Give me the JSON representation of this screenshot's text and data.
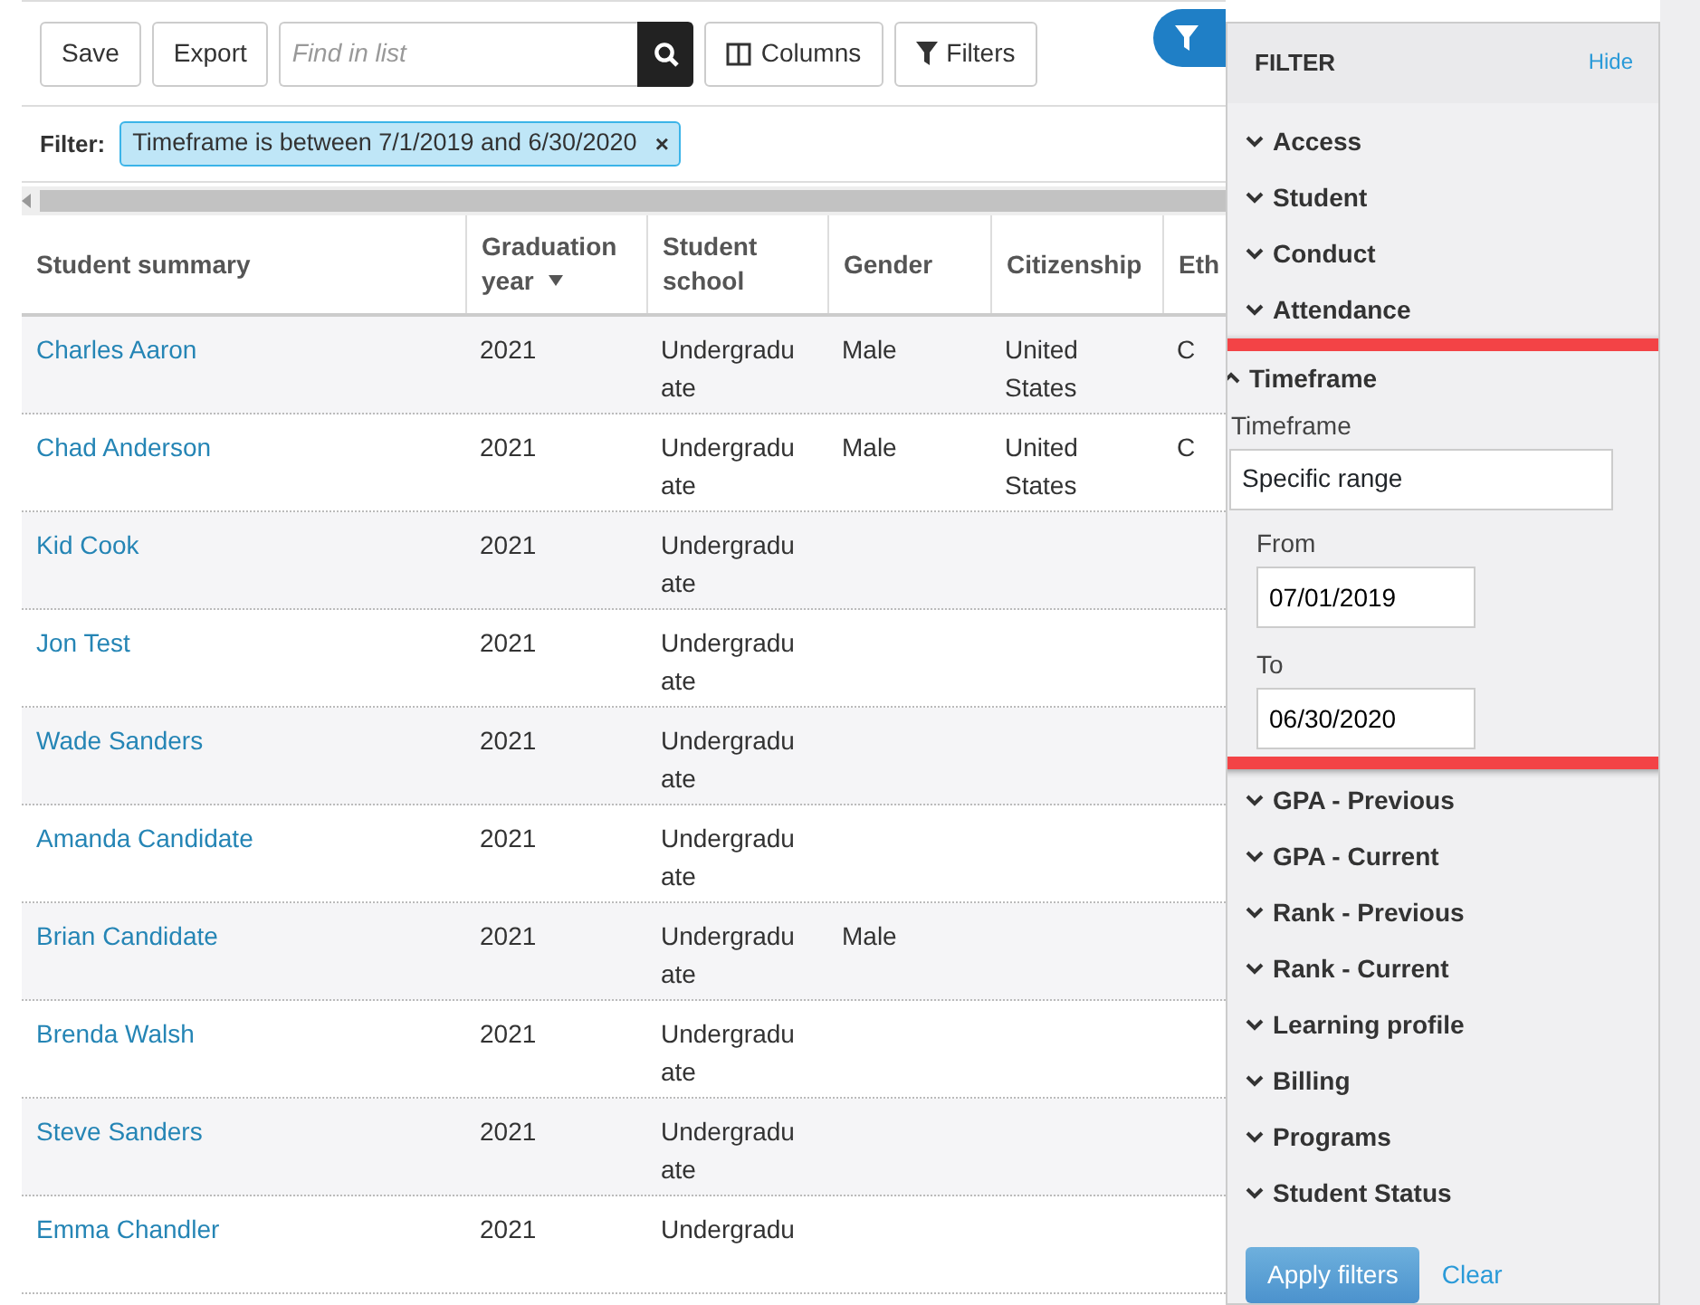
{
  "toolbar": {
    "buttons": [
      {
        "label": "Save",
        "kind": "plain"
      },
      {
        "label": "Export",
        "kind": "plain"
      },
      {
        "label": "Columns",
        "kind": "columns"
      },
      {
        "label": "Filters",
        "kind": "filter"
      }
    ],
    "search": {
      "placeholder": "Find in list"
    }
  },
  "filter_bar": {
    "label": "Filter:",
    "chips": [
      {
        "text": "Timeframe is between 7/1/2019 and 6/30/2020",
        "remove": "×"
      }
    ]
  },
  "table": {
    "columns": [
      {
        "label": "Student summary",
        "sorted": false
      },
      {
        "label": "Graduation year",
        "sorted": true
      },
      {
        "label": "Student school",
        "sorted": false
      },
      {
        "label": "Gender",
        "sorted": false
      },
      {
        "label": "Citizenship",
        "sorted": false
      },
      {
        "label": "Eth",
        "sorted": false
      }
    ],
    "rows": [
      [
        "Charles Aaron",
        "2021",
        "Undergradu ate",
        "Male",
        "United States",
        "C"
      ],
      [
        "Chad Anderson",
        "2021",
        "Undergradu ate",
        "Male",
        "United States",
        "C"
      ],
      [
        "Kid Cook",
        "2021",
        "Undergradu ate",
        "",
        "",
        ""
      ],
      [
        "Jon Test",
        "2021",
        "Undergradu ate",
        "",
        "",
        ""
      ],
      [
        "Wade Sanders",
        "2021",
        "Undergradu ate",
        "",
        "",
        ""
      ],
      [
        "Amanda Candidate",
        "2021",
        "Undergradu ate",
        "",
        "",
        ""
      ],
      [
        "Brian Candidate",
        "2021",
        "Undergradu ate",
        "Male",
        "",
        ""
      ],
      [
        "Brenda Walsh",
        "2021",
        "Undergradu ate",
        "",
        "",
        ""
      ],
      [
        "Steve Sanders",
        "2021",
        "Undergradu ate",
        "",
        "",
        ""
      ],
      [
        "Emma Chandler",
        "2021",
        "Undergradu",
        "",
        "",
        ""
      ]
    ]
  },
  "filter_panel": {
    "title": "FILTER",
    "hide": "Hide",
    "sections": [
      {
        "label": "Access",
        "expanded": false,
        "highlighted": false
      },
      {
        "label": "Student",
        "expanded": false,
        "highlighted": false
      },
      {
        "label": "Conduct",
        "expanded": false,
        "highlighted": false
      },
      {
        "label": "Attendance",
        "expanded": false,
        "highlighted": false
      },
      {
        "label": "Timeframe",
        "expanded": true,
        "highlighted": true,
        "field_label": "Timeframe",
        "select_value": "Specific range",
        "from_label": "From",
        "from_value": "07/01/2019",
        "to_label": "To",
        "to_value": "06/30/2020"
      },
      {
        "label": "GPA - Previous",
        "expanded": false,
        "highlighted": false
      },
      {
        "label": "GPA - Current",
        "expanded": false,
        "highlighted": false
      },
      {
        "label": "Rank - Previous",
        "expanded": false,
        "highlighted": false
      },
      {
        "label": "Rank - Current",
        "expanded": false,
        "highlighted": false
      },
      {
        "label": "Learning profile",
        "expanded": false,
        "highlighted": false
      },
      {
        "label": "Billing",
        "expanded": false,
        "highlighted": false
      },
      {
        "label": "Programs",
        "expanded": false,
        "highlighted": false
      },
      {
        "label": "Student Status",
        "expanded": false,
        "highlighted": false
      }
    ],
    "apply": "Apply filters",
    "clear": "Clear"
  }
}
